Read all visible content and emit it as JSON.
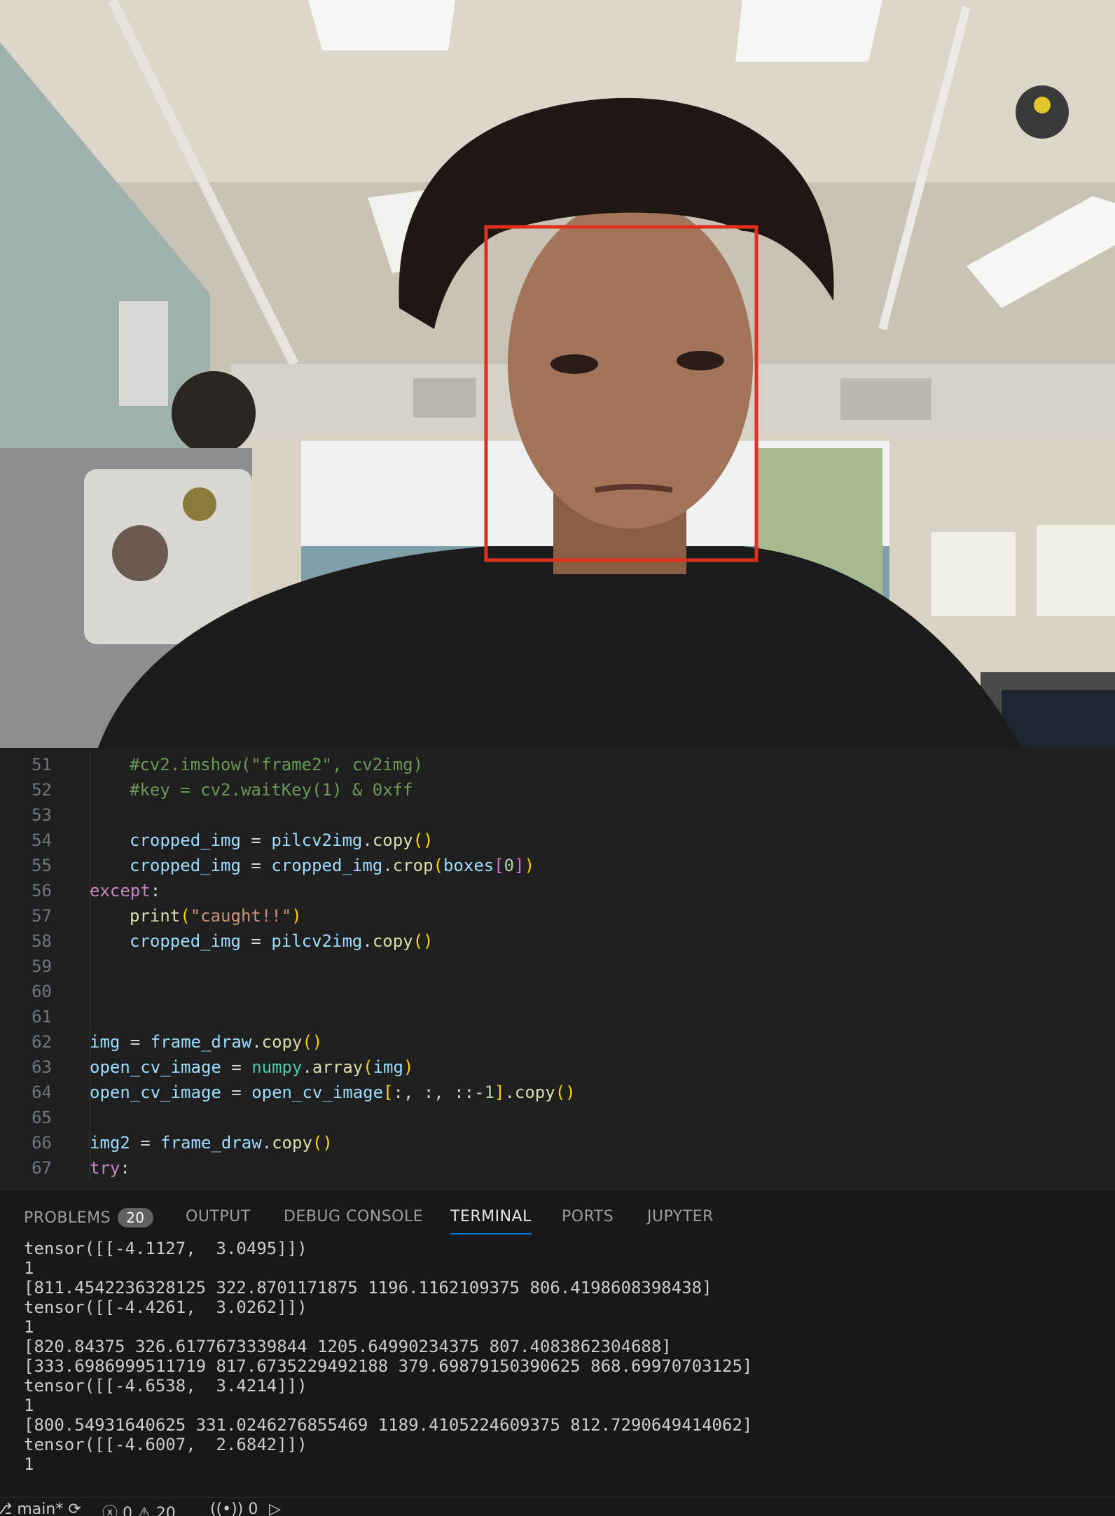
{
  "editor": {
    "lines": [
      {
        "n": "51",
        "segments": [
          {
            "t": "#cv2.imshow(\"frame2\", cv2img)",
            "c": "cmt"
          }
        ],
        "indent": 2
      },
      {
        "n": "52",
        "segments": [
          {
            "t": "#key = cv2.waitKey(1) & 0xff",
            "c": "cmt"
          }
        ],
        "indent": 2
      },
      {
        "n": "53",
        "segments": [],
        "indent": 2
      },
      {
        "n": "54",
        "segments": [
          {
            "t": "cropped_img",
            "c": "var"
          },
          {
            "t": " = ",
            "c": ""
          },
          {
            "t": "pilcv2img",
            "c": "var"
          },
          {
            "t": ".",
            "c": ""
          },
          {
            "t": "copy",
            "c": "fn"
          },
          {
            "t": "()",
            "c": "p1"
          }
        ],
        "indent": 2
      },
      {
        "n": "55",
        "segments": [
          {
            "t": "cropped_img",
            "c": "var"
          },
          {
            "t": " = ",
            "c": ""
          },
          {
            "t": "cropped_img",
            "c": "var"
          },
          {
            "t": ".",
            "c": ""
          },
          {
            "t": "crop",
            "c": "fn"
          },
          {
            "t": "(",
            "c": "p1"
          },
          {
            "t": "boxes",
            "c": "var"
          },
          {
            "t": "[",
            "c": "p2"
          },
          {
            "t": "0",
            "c": "num"
          },
          {
            "t": "]",
            "c": "p2"
          },
          {
            "t": ")",
            "c": "p1"
          }
        ],
        "indent": 2
      },
      {
        "n": "56",
        "segments": [
          {
            "t": "except",
            "c": "kw"
          },
          {
            "t": ":",
            "c": ""
          }
        ],
        "indent": 1
      },
      {
        "n": "57",
        "segments": [
          {
            "t": "print",
            "c": "fn"
          },
          {
            "t": "(",
            "c": "p1"
          },
          {
            "t": "\"caught!!\"",
            "c": "str"
          },
          {
            "t": ")",
            "c": "p1"
          }
        ],
        "indent": 2
      },
      {
        "n": "58",
        "segments": [
          {
            "t": "cropped_img",
            "c": "var"
          },
          {
            "t": " = ",
            "c": ""
          },
          {
            "t": "pilcv2img",
            "c": "var"
          },
          {
            "t": ".",
            "c": ""
          },
          {
            "t": "copy",
            "c": "fn"
          },
          {
            "t": "()",
            "c": "p1"
          }
        ],
        "indent": 2
      },
      {
        "n": "59",
        "segments": [],
        "indent": 1
      },
      {
        "n": "60",
        "segments": [],
        "indent": 1
      },
      {
        "n": "61",
        "segments": [],
        "indent": 1
      },
      {
        "n": "62",
        "segments": [
          {
            "t": "img",
            "c": "var"
          },
          {
            "t": " = ",
            "c": ""
          },
          {
            "t": "frame_draw",
            "c": "var"
          },
          {
            "t": ".",
            "c": ""
          },
          {
            "t": "copy",
            "c": "fn"
          },
          {
            "t": "()",
            "c": "p1"
          }
        ],
        "indent": 1
      },
      {
        "n": "63",
        "segments": [
          {
            "t": "open_cv_image",
            "c": "var"
          },
          {
            "t": " = ",
            "c": ""
          },
          {
            "t": "numpy",
            "c": "cls"
          },
          {
            "t": ".",
            "c": ""
          },
          {
            "t": "array",
            "c": "fn"
          },
          {
            "t": "(",
            "c": "p1"
          },
          {
            "t": "img",
            "c": "var"
          },
          {
            "t": ")",
            "c": "p1"
          }
        ],
        "indent": 1
      },
      {
        "n": "64",
        "segments": [
          {
            "t": "open_cv_image",
            "c": "var"
          },
          {
            "t": " = ",
            "c": ""
          },
          {
            "t": "open_cv_image",
            "c": "var"
          },
          {
            "t": "[",
            "c": "p1"
          },
          {
            "t": ":, :, ::-",
            "c": ""
          },
          {
            "t": "1",
            "c": "num"
          },
          {
            "t": "]",
            "c": "p1"
          },
          {
            "t": ".",
            "c": ""
          },
          {
            "t": "copy",
            "c": "fn"
          },
          {
            "t": "()",
            "c": "p1"
          }
        ],
        "indent": 1
      },
      {
        "n": "65",
        "segments": [],
        "indent": 1
      },
      {
        "n": "66",
        "segments": [
          {
            "t": "img2",
            "c": "var"
          },
          {
            "t": " = ",
            "c": ""
          },
          {
            "t": "frame_draw",
            "c": "var"
          },
          {
            "t": ".",
            "c": ""
          },
          {
            "t": "copy",
            "c": "fn"
          },
          {
            "t": "()",
            "c": "p1"
          }
        ],
        "indent": 1
      },
      {
        "n": "67",
        "segments": [
          {
            "t": "try",
            "c": "kw"
          },
          {
            "t": ":",
            "c": ""
          }
        ],
        "indent": 1
      }
    ]
  },
  "panel": {
    "tabs": [
      {
        "label": "PROBLEMS",
        "badge": "20",
        "active": false
      },
      {
        "label": "OUTPUT",
        "active": false
      },
      {
        "label": "DEBUG CONSOLE",
        "active": false
      },
      {
        "label": "TERMINAL",
        "active": true
      },
      {
        "label": "PORTS",
        "active": false
      },
      {
        "label": "JUPYTER",
        "active": false
      }
    ],
    "terminal_lines": [
      "tensor([[-4.1127,  3.0495]])",
      "1",
      "[811.4542236328125 322.8701171875 1196.1162109375 806.4198608398438]",
      "tensor([[-4.4261,  3.0262]])",
      "1",
      "[820.84375 326.6177673339844 1205.64990234375 807.4083862304688]",
      "[333.6986999511719 817.6735229492188 379.69879150390625 868.69970703125]",
      "tensor([[-4.6538,  3.4214]])",
      "1",
      "[800.54931640625 331.0246276855469 1189.4105224609375 812.7290649414062]",
      "tensor([[-4.6007,  2.6842]])",
      "1"
    ]
  },
  "status": {
    "branch": "main*",
    "errors": "0",
    "warnings": "20",
    "ports": "0"
  },
  "colors": {
    "detection_box": "#e0301e",
    "tab_active_underline": "#0078d4"
  }
}
